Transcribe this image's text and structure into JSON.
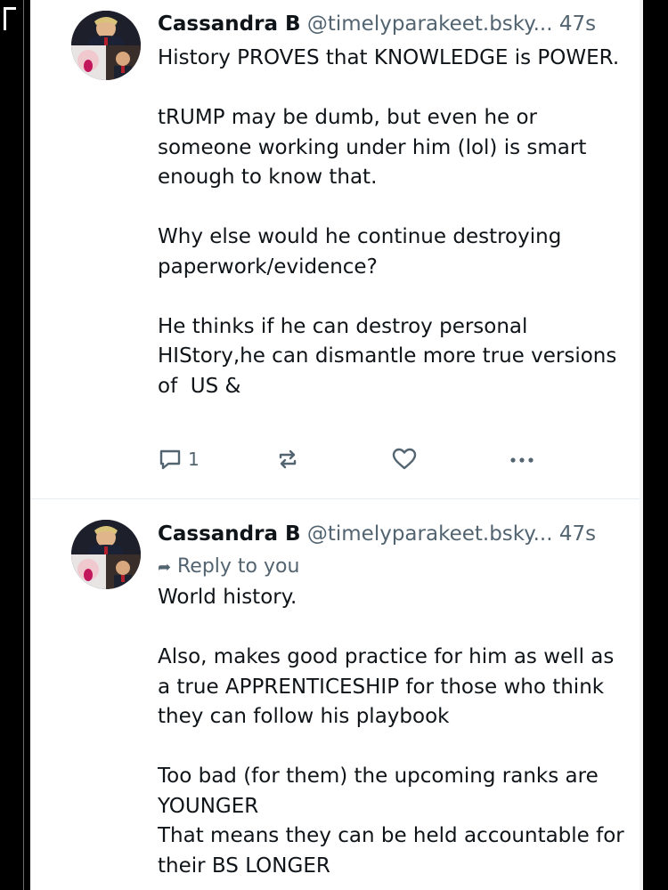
{
  "posts": [
    {
      "display_name": "Cassandra B",
      "handle": "@timelyparakeet.bsky...",
      "time": "47s",
      "reply_to": "",
      "text": "History PROVES that KNOWLEDGE is POWER.\n\ntRUMP may be dumb, but even he or someone working under him (lol) is smart enough to know that.\n\nWhy else would he continue destroying paperwork/evidence?\n\nHe thinks if he can destroy personal HIStory,he can dismantle more true versions of  US &",
      "reply_count": "1",
      "icons": {
        "reply": "comment-icon",
        "repost": "repost-icon",
        "like": "heart-icon",
        "more": "ellipsis-icon"
      }
    },
    {
      "display_name": "Cassandra B",
      "handle": "@timelyparakeet.bsky...",
      "time": "47s",
      "reply_to": "Reply to you",
      "text": "World history.\n\nAlso, makes good practice for him as well as a true APPRENTICESHIP for those who think they can follow his playbook\n\nToo bad (for them) the upcoming ranks are YOUNGER\nThat means they can be held accountable for their BS LONGER"
    }
  ],
  "colors": {
    "text": "#0f1419",
    "muted": "#536471",
    "divider": "#e6ecf0",
    "reply_link": "#536471"
  }
}
